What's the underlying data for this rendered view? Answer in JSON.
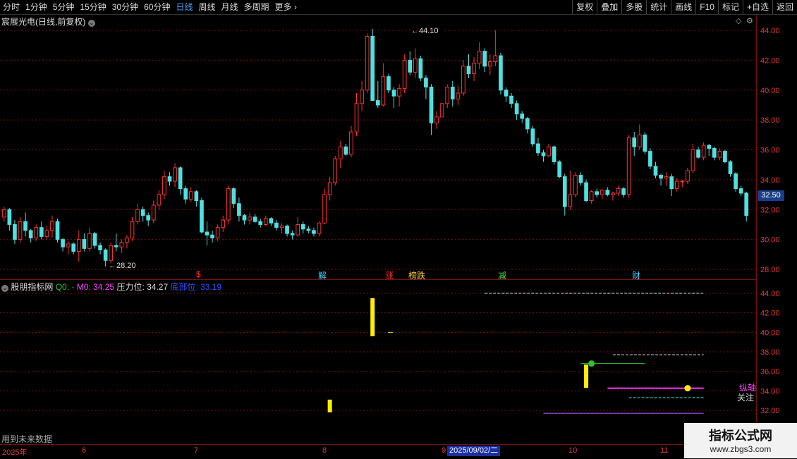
{
  "toolbar": {
    "periods": [
      "分时",
      "1分钟",
      "5分钟",
      "15分钟",
      "30分钟",
      "60分钟",
      "日线",
      "周线",
      "月线",
      "多周期",
      "更多"
    ],
    "active_period": "日线",
    "buttons": [
      "复权",
      "叠加",
      "多股",
      "统计",
      "画线",
      "F10",
      "标记",
      "+自选",
      "返回"
    ]
  },
  "main_chart": {
    "title": "宸展光电(日线,前复权)",
    "high_label": "44.10",
    "low_label": "28.20",
    "current_price": "32.50",
    "y_ticks": [
      "44.00",
      "42.00",
      "40.00",
      "38.00",
      "36.00",
      "34.00",
      "32.00",
      "30.00",
      "28.00"
    ],
    "markers": [
      {
        "text": "$",
        "color": "#ff3030"
      },
      {
        "text": "解",
        "color": "#40d0ff"
      },
      {
        "text": "涨",
        "color": "#ff3030"
      },
      {
        "text": "榜跌",
        "color": "#ffd040"
      },
      {
        "text": "减",
        "color": "#40e040"
      },
      {
        "text": "财",
        "color": "#40d0ff"
      }
    ]
  },
  "indicator": {
    "name": "股朋指标网",
    "q0": "Q0: -",
    "m0": "M0: 34.25",
    "pressure": "压力位: 34.27",
    "bottom": "底部位: 33.19",
    "y_ticks": [
      "44.00",
      "42.00",
      "40.00",
      "38.00",
      "36.00",
      "34.00",
      "32.00"
    ],
    "label_breakout": "纵轴",
    "label_watch": "关注",
    "future_note": "用到未来数据"
  },
  "date_axis": {
    "labels": [
      "2025年",
      "6",
      "7",
      "8",
      "9",
      "10",
      "11"
    ],
    "cursor_date": "2025/09/02/二"
  },
  "watermark": {
    "title": "指标公式网",
    "url": "www.zbgs3.com"
  },
  "colors": {
    "up": "#ff3232",
    "down": "#50e0e0",
    "grid": "#7a1010",
    "accent": "#1a3d8a"
  },
  "chart_data": {
    "type": "candlestick",
    "ylim": [
      28,
      44
    ],
    "candles": [
      [
        31.5,
        32.2,
        31.2,
        32.0
      ],
      [
        32.0,
        32.1,
        30.6,
        31.0
      ],
      [
        31.0,
        31.3,
        29.7,
        30.0
      ],
      [
        30.0,
        31.5,
        29.8,
        31.2
      ],
      [
        31.2,
        31.8,
        30.2,
        30.6
      ],
      [
        30.6,
        30.7,
        29.8,
        30.1
      ],
      [
        30.1,
        31.0,
        29.9,
        30.8
      ],
      [
        30.8,
        31.2,
        30.0,
        30.2
      ],
      [
        30.2,
        30.9,
        30.0,
        30.6
      ],
      [
        30.6,
        31.6,
        30.1,
        31.2
      ],
      [
        31.2,
        31.4,
        29.8,
        30.0
      ],
      [
        30.0,
        30.1,
        29.2,
        29.5
      ],
      [
        29.5,
        29.9,
        29.0,
        29.7
      ],
      [
        29.7,
        29.8,
        29.0,
        29.2
      ],
      [
        29.2,
        30.6,
        28.5,
        30.0
      ],
      [
        30.0,
        30.4,
        29.2,
        29.4
      ],
      [
        29.4,
        30.8,
        29.2,
        30.4
      ],
      [
        30.4,
        30.5,
        29.4,
        29.6
      ],
      [
        29.6,
        29.8,
        29.0,
        29.3
      ],
      [
        29.3,
        29.4,
        28.2,
        28.6
      ],
      [
        28.6,
        29.8,
        28.4,
        29.6
      ],
      [
        29.6,
        30.4,
        29.2,
        29.5
      ],
      [
        29.5,
        30.0,
        29.1,
        29.8
      ],
      [
        29.8,
        30.3,
        29.4,
        30.1
      ],
      [
        30.1,
        31.5,
        29.9,
        31.2
      ],
      [
        31.2,
        32.4,
        31.0,
        32.0
      ],
      [
        32.0,
        32.2,
        31.2,
        31.6
      ],
      [
        31.6,
        31.8,
        30.9,
        31.3
      ],
      [
        31.3,
        32.6,
        31.1,
        32.3
      ],
      [
        32.3,
        33.3,
        32.0,
        33.0
      ],
      [
        33.0,
        34.6,
        32.7,
        34.2
      ],
      [
        34.2,
        34.5,
        33.6,
        33.9
      ],
      [
        33.9,
        35.1,
        33.5,
        34.8
      ],
      [
        34.8,
        34.9,
        33.0,
        33.4
      ],
      [
        33.4,
        33.6,
        32.4,
        32.7
      ],
      [
        32.7,
        33.5,
        32.5,
        33.2
      ],
      [
        33.2,
        33.3,
        32.2,
        32.6
      ],
      [
        32.6,
        32.8,
        30.4,
        30.5
      ],
      [
        30.5,
        31.2,
        29.6,
        30.3
      ],
      [
        30.3,
        30.6,
        29.8,
        30.1
      ],
      [
        30.1,
        31.0,
        29.9,
        30.8
      ],
      [
        30.8,
        31.6,
        30.5,
        31.3
      ],
      [
        31.3,
        33.6,
        31.0,
        33.4
      ],
      [
        33.4,
        33.5,
        32.1,
        32.4
      ],
      [
        32.4,
        32.8,
        31.2,
        31.6
      ],
      [
        31.6,
        31.7,
        31.0,
        31.3
      ],
      [
        31.3,
        31.8,
        31.0,
        31.5
      ],
      [
        31.5,
        31.7,
        31.1,
        31.2
      ],
      [
        31.2,
        31.4,
        30.8,
        31.0
      ],
      [
        31.0,
        31.6,
        30.9,
        31.4
      ],
      [
        31.4,
        31.5,
        30.9,
        31.1
      ],
      [
        31.1,
        31.3,
        30.6,
        30.8
      ],
      [
        30.8,
        31.1,
        30.4,
        30.9
      ],
      [
        30.9,
        31.0,
        30.2,
        30.4
      ],
      [
        30.4,
        30.6,
        30.0,
        30.3
      ],
      [
        30.3,
        31.5,
        30.2,
        31.0
      ],
      [
        31.0,
        31.2,
        30.4,
        30.7
      ],
      [
        30.7,
        30.9,
        30.4,
        30.6
      ],
      [
        30.6,
        30.8,
        30.2,
        30.4
      ],
      [
        30.4,
        31.2,
        30.2,
        31.1
      ],
      [
        31.1,
        33.4,
        31.0,
        33.0
      ],
      [
        33.0,
        34.2,
        32.6,
        33.8
      ],
      [
        33.8,
        35.6,
        33.6,
        35.4
      ],
      [
        35.4,
        36.6,
        34.8,
        36.2
      ],
      [
        36.2,
        36.4,
        35.6,
        35.7
      ],
      [
        35.7,
        37.6,
        35.5,
        37.2
      ],
      [
        37.2,
        39.8,
        36.9,
        39.1
      ],
      [
        39.1,
        40.6,
        38.6,
        40.0
      ],
      [
        40.0,
        43.8,
        39.8,
        43.6
      ],
      [
        43.6,
        44.1,
        39.3,
        39.3
      ],
      [
        39.3,
        40.6,
        38.8,
        39.0
      ],
      [
        39.0,
        41.8,
        38.9,
        40.9
      ],
      [
        40.9,
        41.1,
        39.8,
        40.0
      ],
      [
        40.0,
        40.2,
        38.8,
        39.6
      ],
      [
        39.6,
        40.4,
        38.9,
        40.1
      ],
      [
        40.1,
        42.4,
        39.8,
        42.0
      ],
      [
        42.0,
        42.6,
        41.0,
        41.2
      ],
      [
        41.2,
        42.8,
        40.8,
        42.1
      ],
      [
        42.1,
        42.3,
        40.6,
        40.8
      ],
      [
        40.8,
        41.0,
        39.4,
        40.2
      ],
      [
        40.2,
        40.4,
        37.0,
        37.8
      ],
      [
        37.8,
        38.6,
        37.4,
        38.2
      ],
      [
        38.2,
        38.4,
        39.1,
        39.1
      ],
      [
        39.1,
        40.4,
        38.8,
        40.2
      ],
      [
        40.2,
        40.6,
        38.9,
        39.4
      ],
      [
        39.4,
        40.3,
        39.0,
        39.8
      ],
      [
        39.8,
        42.0,
        39.6,
        41.6
      ],
      [
        41.6,
        42.4,
        40.8,
        41.1
      ],
      [
        41.1,
        42.2,
        40.6,
        41.8
      ],
      [
        41.8,
        43.2,
        41.4,
        42.6
      ],
      [
        42.6,
        42.8,
        41.2,
        41.6
      ],
      [
        41.6,
        42.4,
        41.0,
        41.9
      ],
      [
        41.9,
        44.0,
        41.6,
        42.3
      ],
      [
        42.3,
        42.5,
        39.7,
        40.0
      ],
      [
        40.0,
        40.2,
        39.2,
        39.6
      ],
      [
        39.6,
        39.8,
        38.8,
        39.1
      ],
      [
        39.1,
        39.3,
        38.0,
        38.4
      ],
      [
        38.4,
        38.6,
        37.8,
        38.1
      ],
      [
        38.1,
        38.2,
        37.1,
        37.4
      ],
      [
        37.4,
        37.6,
        36.2,
        36.4
      ],
      [
        36.4,
        36.8,
        35.6,
        35.8
      ],
      [
        35.8,
        36.0,
        35.2,
        35.6
      ],
      [
        35.6,
        36.4,
        35.5,
        36.2
      ],
      [
        36.2,
        36.3,
        35.0,
        35.2
      ],
      [
        35.2,
        35.3,
        34.1,
        34.2
      ],
      [
        34.2,
        34.4,
        31.6,
        32.2
      ],
      [
        32.2,
        34.6,
        32.0,
        33.0
      ],
      [
        33.0,
        34.5,
        32.8,
        34.3
      ],
      [
        34.3,
        34.5,
        33.6,
        33.8
      ],
      [
        33.8,
        34.0,
        32.5,
        32.6
      ],
      [
        32.6,
        33.3,
        32.4,
        33.2
      ],
      [
        33.2,
        33.4,
        32.8,
        33.0
      ],
      [
        33.0,
        33.4,
        32.7,
        33.3
      ],
      [
        33.3,
        33.5,
        32.9,
        33.0
      ],
      [
        33.0,
        33.2,
        32.6,
        33.1
      ],
      [
        33.1,
        33.6,
        32.9,
        33.4
      ],
      [
        33.4,
        33.5,
        32.8,
        33.0
      ],
      [
        33.0,
        37.0,
        32.8,
        36.8
      ],
      [
        36.8,
        37.2,
        35.6,
        36.2
      ],
      [
        36.2,
        37.7,
        36.0,
        37.0
      ],
      [
        37.0,
        37.2,
        35.7,
        35.9
      ],
      [
        35.9,
        36.1,
        34.7,
        34.9
      ],
      [
        34.9,
        35.2,
        34.1,
        34.3
      ],
      [
        34.3,
        34.4,
        33.6,
        34.1
      ],
      [
        34.1,
        34.5,
        33.6,
        34.2
      ],
      [
        34.2,
        34.4,
        32.9,
        33.4
      ],
      [
        33.4,
        34.1,
        33.2,
        33.9
      ],
      [
        33.9,
        34.0,
        33.5,
        33.9
      ],
      [
        33.9,
        34.8,
        33.7,
        34.6
      ],
      [
        34.6,
        36.4,
        34.4,
        36.0
      ],
      [
        36.0,
        36.2,
        35.4,
        35.5
      ],
      [
        35.5,
        36.5,
        35.3,
        36.3
      ],
      [
        36.3,
        36.4,
        35.6,
        36.1
      ],
      [
        36.1,
        36.2,
        35.3,
        35.5
      ],
      [
        35.5,
        36.1,
        35.3,
        35.9
      ],
      [
        35.9,
        36.0,
        35.1,
        35.2
      ],
      [
        35.2,
        35.3,
        34.2,
        34.4
      ],
      [
        34.4,
        34.5,
        33.2,
        33.4
      ],
      [
        33.4,
        33.6,
        32.9,
        33.1
      ],
      [
        33.1,
        33.2,
        31.2,
        31.6
      ]
    ],
    "indicator_bars": [
      {
        "index": 61,
        "from": 31.8,
        "to": 33.1,
        "color": "#ffee00"
      },
      {
        "index": 69,
        "from": 39.6,
        "to": 43.5,
        "color": "#ffee00"
      },
      {
        "index": 109,
        "from": 34.3,
        "to": 36.7,
        "color": "#ffee00"
      }
    ],
    "indicator_lines": [
      {
        "from_index": 90,
        "to_index": 131,
        "value": 44.0,
        "color": "#dddddd",
        "dash": true
      },
      {
        "from_index": 114,
        "to_index": 131,
        "value": 37.7,
        "color": "#dddddd",
        "dash": true
      },
      {
        "from_index": 108,
        "to_index": 120,
        "value": 36.8,
        "color": "#30c030",
        "dash": false
      },
      {
        "from_index": 113,
        "to_index": 131,
        "value": 34.27,
        "color": "#ff30ff",
        "dash": false
      },
      {
        "from_index": 117,
        "to_index": 131,
        "value": 33.3,
        "color": "#50e0e0",
        "dash": true
      },
      {
        "from_index": 101,
        "to_index": 131,
        "value": 31.7,
        "color": "#c060ff",
        "dash": false
      }
    ],
    "indicator_dots": [
      {
        "index": 110,
        "value": 36.8,
        "color": "#30c030"
      },
      {
        "index": 128,
        "value": 34.27,
        "color": "#ffee00"
      }
    ],
    "indicator_ylim": [
      30.5,
      45.5
    ]
  }
}
